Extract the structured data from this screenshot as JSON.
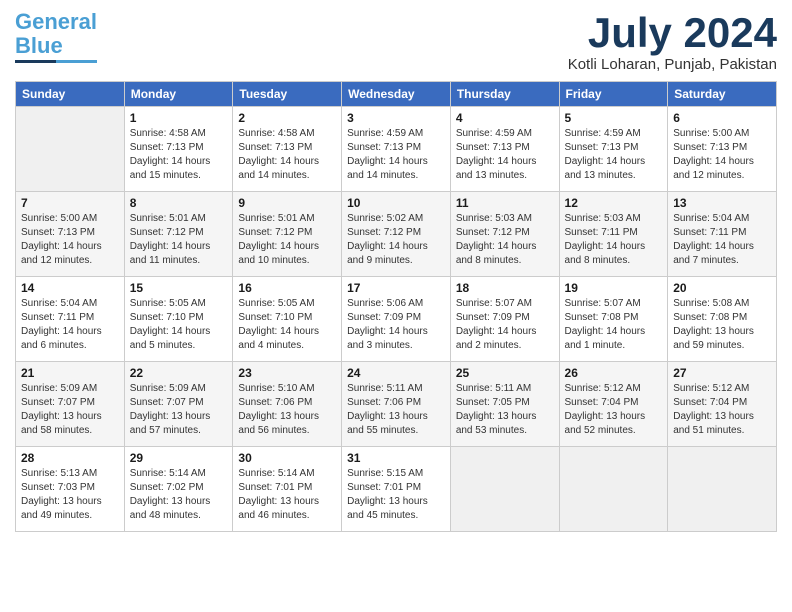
{
  "header": {
    "logo_general": "General",
    "logo_blue": "Blue",
    "month_title": "July 2024",
    "location": "Kotli Loharan, Punjab, Pakistan"
  },
  "days_of_week": [
    "Sunday",
    "Monday",
    "Tuesday",
    "Wednesday",
    "Thursday",
    "Friday",
    "Saturday"
  ],
  "weeks": [
    [
      {
        "day": "",
        "sunrise": "",
        "sunset": "",
        "daylight": ""
      },
      {
        "day": "1",
        "sunrise": "Sunrise: 4:58 AM",
        "sunset": "Sunset: 7:13 PM",
        "daylight": "Daylight: 14 hours and 15 minutes."
      },
      {
        "day": "2",
        "sunrise": "Sunrise: 4:58 AM",
        "sunset": "Sunset: 7:13 PM",
        "daylight": "Daylight: 14 hours and 14 minutes."
      },
      {
        "day": "3",
        "sunrise": "Sunrise: 4:59 AM",
        "sunset": "Sunset: 7:13 PM",
        "daylight": "Daylight: 14 hours and 14 minutes."
      },
      {
        "day": "4",
        "sunrise": "Sunrise: 4:59 AM",
        "sunset": "Sunset: 7:13 PM",
        "daylight": "Daylight: 14 hours and 13 minutes."
      },
      {
        "day": "5",
        "sunrise": "Sunrise: 4:59 AM",
        "sunset": "Sunset: 7:13 PM",
        "daylight": "Daylight: 14 hours and 13 minutes."
      },
      {
        "day": "6",
        "sunrise": "Sunrise: 5:00 AM",
        "sunset": "Sunset: 7:13 PM",
        "daylight": "Daylight: 14 hours and 12 minutes."
      }
    ],
    [
      {
        "day": "7",
        "sunrise": "Sunrise: 5:00 AM",
        "sunset": "Sunset: 7:13 PM",
        "daylight": "Daylight: 14 hours and 12 minutes."
      },
      {
        "day": "8",
        "sunrise": "Sunrise: 5:01 AM",
        "sunset": "Sunset: 7:12 PM",
        "daylight": "Daylight: 14 hours and 11 minutes."
      },
      {
        "day": "9",
        "sunrise": "Sunrise: 5:01 AM",
        "sunset": "Sunset: 7:12 PM",
        "daylight": "Daylight: 14 hours and 10 minutes."
      },
      {
        "day": "10",
        "sunrise": "Sunrise: 5:02 AM",
        "sunset": "Sunset: 7:12 PM",
        "daylight": "Daylight: 14 hours and 9 minutes."
      },
      {
        "day": "11",
        "sunrise": "Sunrise: 5:03 AM",
        "sunset": "Sunset: 7:12 PM",
        "daylight": "Daylight: 14 hours and 8 minutes."
      },
      {
        "day": "12",
        "sunrise": "Sunrise: 5:03 AM",
        "sunset": "Sunset: 7:11 PM",
        "daylight": "Daylight: 14 hours and 8 minutes."
      },
      {
        "day": "13",
        "sunrise": "Sunrise: 5:04 AM",
        "sunset": "Sunset: 7:11 PM",
        "daylight": "Daylight: 14 hours and 7 minutes."
      }
    ],
    [
      {
        "day": "14",
        "sunrise": "Sunrise: 5:04 AM",
        "sunset": "Sunset: 7:11 PM",
        "daylight": "Daylight: 14 hours and 6 minutes."
      },
      {
        "day": "15",
        "sunrise": "Sunrise: 5:05 AM",
        "sunset": "Sunset: 7:10 PM",
        "daylight": "Daylight: 14 hours and 5 minutes."
      },
      {
        "day": "16",
        "sunrise": "Sunrise: 5:05 AM",
        "sunset": "Sunset: 7:10 PM",
        "daylight": "Daylight: 14 hours and 4 minutes."
      },
      {
        "day": "17",
        "sunrise": "Sunrise: 5:06 AM",
        "sunset": "Sunset: 7:09 PM",
        "daylight": "Daylight: 14 hours and 3 minutes."
      },
      {
        "day": "18",
        "sunrise": "Sunrise: 5:07 AM",
        "sunset": "Sunset: 7:09 PM",
        "daylight": "Daylight: 14 hours and 2 minutes."
      },
      {
        "day": "19",
        "sunrise": "Sunrise: 5:07 AM",
        "sunset": "Sunset: 7:08 PM",
        "daylight": "Daylight: 14 hours and 1 minute."
      },
      {
        "day": "20",
        "sunrise": "Sunrise: 5:08 AM",
        "sunset": "Sunset: 7:08 PM",
        "daylight": "Daylight: 13 hours and 59 minutes."
      }
    ],
    [
      {
        "day": "21",
        "sunrise": "Sunrise: 5:09 AM",
        "sunset": "Sunset: 7:07 PM",
        "daylight": "Daylight: 13 hours and 58 minutes."
      },
      {
        "day": "22",
        "sunrise": "Sunrise: 5:09 AM",
        "sunset": "Sunset: 7:07 PM",
        "daylight": "Daylight: 13 hours and 57 minutes."
      },
      {
        "day": "23",
        "sunrise": "Sunrise: 5:10 AM",
        "sunset": "Sunset: 7:06 PM",
        "daylight": "Daylight: 13 hours and 56 minutes."
      },
      {
        "day": "24",
        "sunrise": "Sunrise: 5:11 AM",
        "sunset": "Sunset: 7:06 PM",
        "daylight": "Daylight: 13 hours and 55 minutes."
      },
      {
        "day": "25",
        "sunrise": "Sunrise: 5:11 AM",
        "sunset": "Sunset: 7:05 PM",
        "daylight": "Daylight: 13 hours and 53 minutes."
      },
      {
        "day": "26",
        "sunrise": "Sunrise: 5:12 AM",
        "sunset": "Sunset: 7:04 PM",
        "daylight": "Daylight: 13 hours and 52 minutes."
      },
      {
        "day": "27",
        "sunrise": "Sunrise: 5:12 AM",
        "sunset": "Sunset: 7:04 PM",
        "daylight": "Daylight: 13 hours and 51 minutes."
      }
    ],
    [
      {
        "day": "28",
        "sunrise": "Sunrise: 5:13 AM",
        "sunset": "Sunset: 7:03 PM",
        "daylight": "Daylight: 13 hours and 49 minutes."
      },
      {
        "day": "29",
        "sunrise": "Sunrise: 5:14 AM",
        "sunset": "Sunset: 7:02 PM",
        "daylight": "Daylight: 13 hours and 48 minutes."
      },
      {
        "day": "30",
        "sunrise": "Sunrise: 5:14 AM",
        "sunset": "Sunset: 7:01 PM",
        "daylight": "Daylight: 13 hours and 46 minutes."
      },
      {
        "day": "31",
        "sunrise": "Sunrise: 5:15 AM",
        "sunset": "Sunset: 7:01 PM",
        "daylight": "Daylight: 13 hours and 45 minutes."
      },
      {
        "day": "",
        "sunrise": "",
        "sunset": "",
        "daylight": ""
      },
      {
        "day": "",
        "sunrise": "",
        "sunset": "",
        "daylight": ""
      },
      {
        "day": "",
        "sunrise": "",
        "sunset": "",
        "daylight": ""
      }
    ]
  ]
}
